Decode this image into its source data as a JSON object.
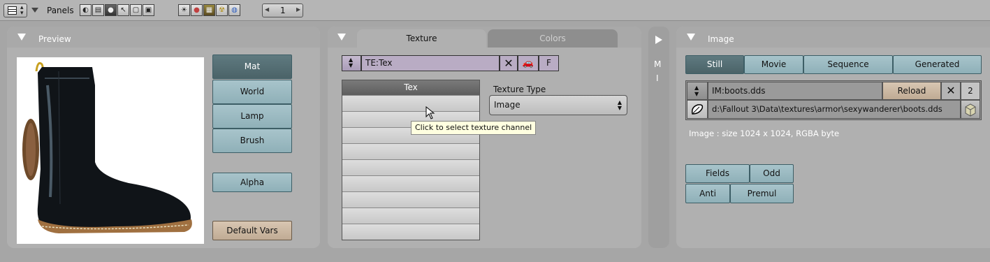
{
  "header": {
    "panels_label": "Panels",
    "frame_value": "1",
    "frame_prev": "◀",
    "frame_next": "▶"
  },
  "preview": {
    "title": "Preview",
    "buttons": [
      "Mat",
      "World",
      "Lamp",
      "Brush"
    ],
    "alpha": "Alpha",
    "default_vars": "Default Vars"
  },
  "texture": {
    "tab_texture": "Texture",
    "tab_colors": "Colors",
    "te_name": "TE:Tex",
    "f_label": "F",
    "channel_header": "Tex",
    "type_label": "Texture Type",
    "type_value": "Image",
    "tooltip": "Click to select texture channel"
  },
  "side": {
    "letters": [
      "M",
      "I"
    ]
  },
  "image": {
    "title": "Image",
    "source_tabs": [
      "Still",
      "Movie",
      "Sequence",
      "Generated"
    ],
    "im_name": "IM:boots.dds",
    "reload": "Reload",
    "users": "2",
    "path": "d:\\Fallout 3\\Data\\textures\\armor\\sexywanderer\\boots.dds",
    "info": "Image : size 1024 x 1024, RGBA byte",
    "fields": "Fields",
    "odd": "Odd",
    "anti": "Anti",
    "premul": "Premul"
  },
  "colors": {
    "accent_selected": "#4b6368",
    "button_blue": "#9ab8bf",
    "button_tan": "#c8b49e",
    "texture_name_field": "#b9acc4",
    "tooltip_bg": "#ffffe0"
  }
}
